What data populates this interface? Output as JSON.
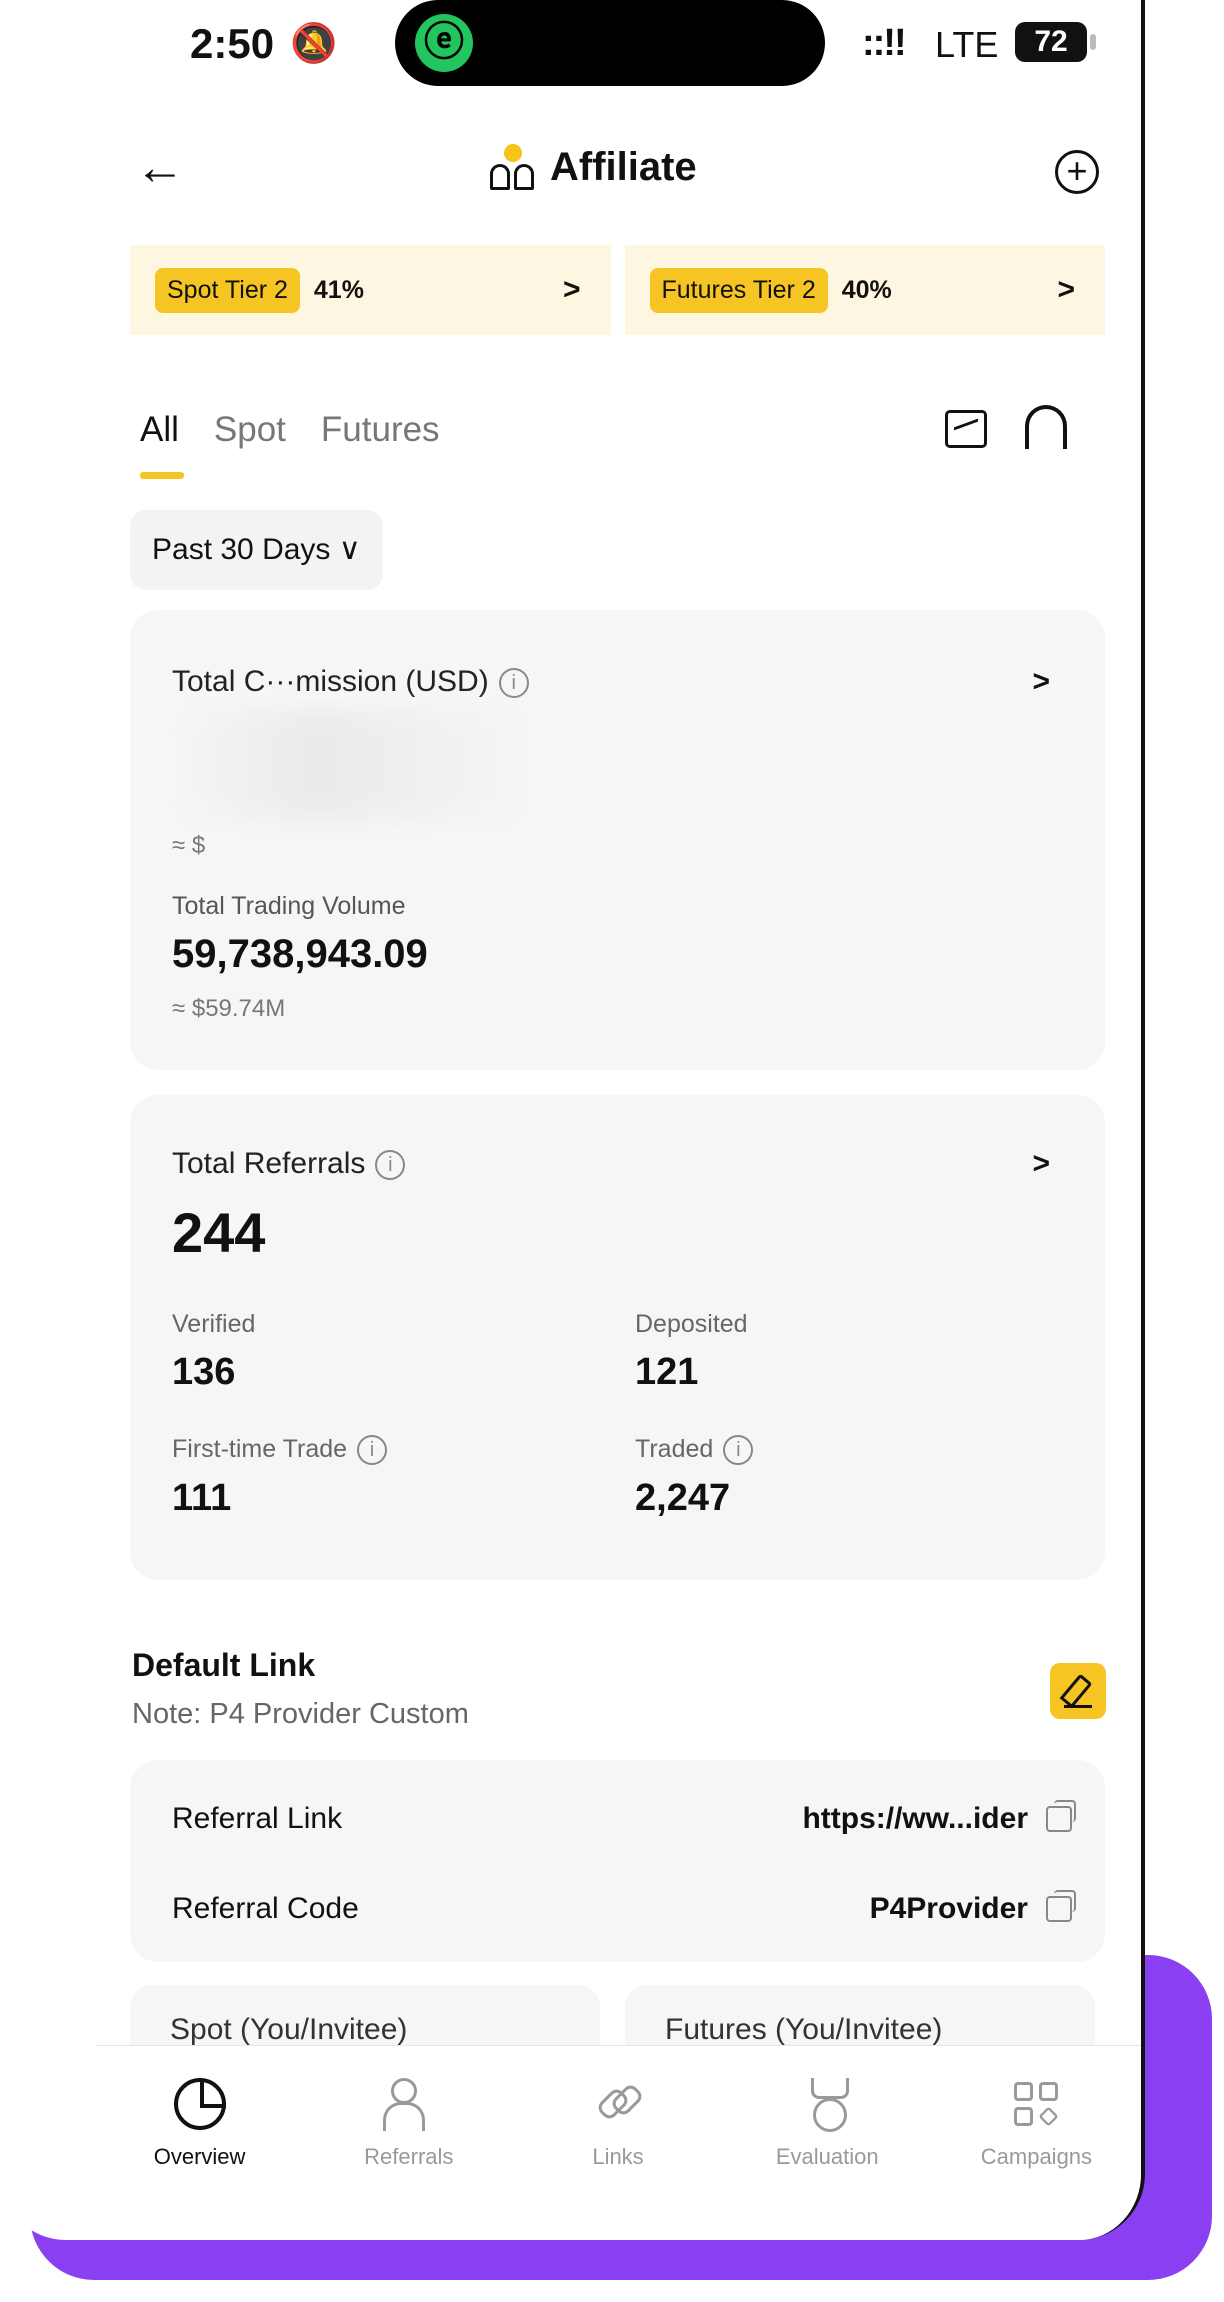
{
  "status_bar": {
    "time": "2:50",
    "mute_icon": "bell-slash-icon",
    "carrier": "LTE",
    "battery": "72",
    "signal": "::!!"
  },
  "header": {
    "title": "Affiliate",
    "back_icon": "arrow-left-icon",
    "add_icon": "plus-circle-icon"
  },
  "tiers": [
    {
      "badge": "Spot Tier 2",
      "percent": "41%",
      "arrow": ">"
    },
    {
      "badge": "Futures Tier 2",
      "percent": "40%",
      "arrow": ">"
    }
  ],
  "tabs": [
    {
      "label": "All",
      "active": true
    },
    {
      "label": "Spot",
      "active": false
    },
    {
      "label": "Futures",
      "active": false
    }
  ],
  "range": {
    "label": "Past 30 Days ∨"
  },
  "commission": {
    "label": "Total C···mission (USD)",
    "arrow": ">",
    "approx_prefix": "≈ $"
  },
  "volume": {
    "label": "Total Trading Volume",
    "value": "59,738,943.09",
    "approx": "≈ $59.74M"
  },
  "referrals": {
    "label": "Total Referrals",
    "value": "244",
    "arrow": ">",
    "verified_label": "Verified",
    "verified_value": "136",
    "deposited_label": "Deposited",
    "deposited_value": "121",
    "first_trade_label": "First-time Trade",
    "first_trade_value": "111",
    "traded_label": "Traded",
    "traded_value": "2,247"
  },
  "default_link": {
    "title": "Default Link",
    "note": "Note: P4 Provider Custom",
    "referral_link_label": "Referral Link",
    "referral_link_value": "https://ww...ider",
    "referral_code_label": "Referral Code",
    "referral_code_value": "P4Provider"
  },
  "peek": {
    "spot": "Spot (You/Invitee)",
    "futures": "Futures (You/Invitee)"
  },
  "bottom_nav": [
    {
      "label": "Overview",
      "active": true
    },
    {
      "label": "Referrals",
      "active": false
    },
    {
      "label": "Links",
      "active": false
    },
    {
      "label": "Evaluation",
      "active": false
    },
    {
      "label": "Campaigns",
      "active": false
    }
  ],
  "colors": {
    "accent": "#f6c523",
    "frame": "#8a3ff2"
  }
}
